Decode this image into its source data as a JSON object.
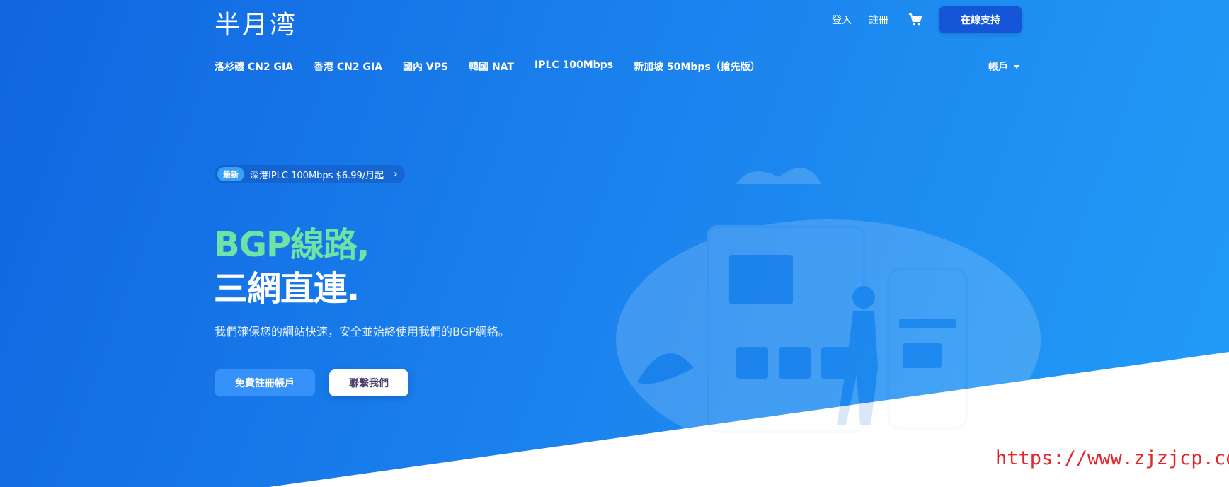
{
  "brand": {
    "logo_text": "半月湾"
  },
  "top_nav": {
    "login": "登入",
    "register": "註冊",
    "cart_icon": "cart-icon",
    "support_button": "在線支持"
  },
  "main_nav": {
    "items": [
      "洛杉磯 CN2 GIA",
      "香港 CN2 GIA",
      "國內 VPS",
      "韓國 NAT",
      "IPLC 100Mbps",
      "新加坡 50Mbps（搶先版）"
    ],
    "account": "帳戶"
  },
  "hero": {
    "promo_badge": "最新",
    "promo_text": "深港IPLC 100Mbps $6.99/月起",
    "headline_line1": "BGP線路,",
    "headline_line2": "三網直連.",
    "description": "我們確保您的網站快速，安全並始終使用我們的BGP網絡。",
    "primary_button": "免費註冊帳戶",
    "secondary_button": "聯繫我們"
  },
  "watermark": "https://www.zjzjcp.com",
  "colors": {
    "hero_start": "#1066e0",
    "hero_end": "#229cf7",
    "headline_green": "#6fe3a6",
    "support_button": "#1556d8",
    "primary_button": "#3692f8",
    "watermark": "#e3262a"
  }
}
